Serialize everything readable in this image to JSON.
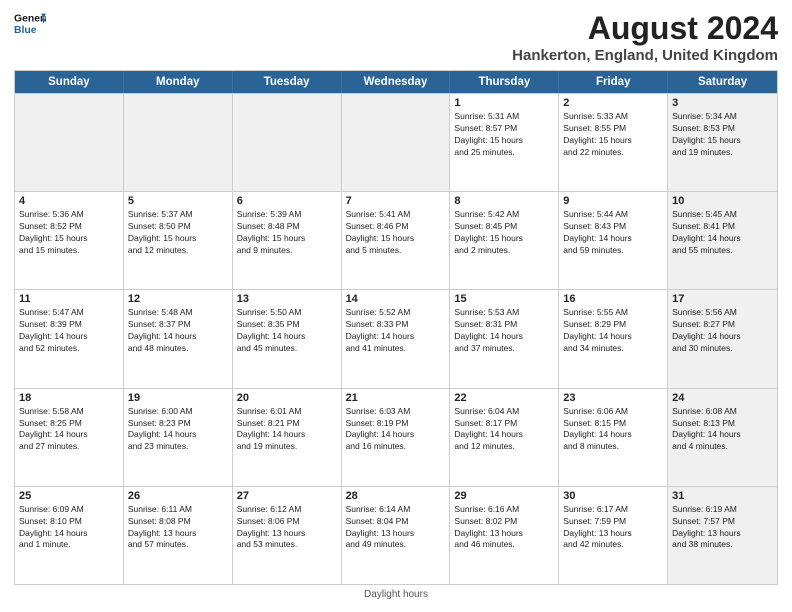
{
  "header": {
    "logo_line1": "General",
    "logo_line2": "Blue",
    "main_title": "August 2024",
    "subtitle": "Hankerton, England, United Kingdom"
  },
  "days_of_week": [
    "Sunday",
    "Monday",
    "Tuesday",
    "Wednesday",
    "Thursday",
    "Friday",
    "Saturday"
  ],
  "footer_text": "Daylight hours",
  "rows": [
    [
      {
        "day": "",
        "info": "",
        "shaded": true
      },
      {
        "day": "",
        "info": "",
        "shaded": true
      },
      {
        "day": "",
        "info": "",
        "shaded": true
      },
      {
        "day": "",
        "info": "",
        "shaded": true
      },
      {
        "day": "1",
        "info": "Sunrise: 5:31 AM\nSunset: 8:57 PM\nDaylight: 15 hours\nand 25 minutes.",
        "shaded": false
      },
      {
        "day": "2",
        "info": "Sunrise: 5:33 AM\nSunset: 8:55 PM\nDaylight: 15 hours\nand 22 minutes.",
        "shaded": false
      },
      {
        "day": "3",
        "info": "Sunrise: 5:34 AM\nSunset: 8:53 PM\nDaylight: 15 hours\nand 19 minutes.",
        "shaded": true
      }
    ],
    [
      {
        "day": "4",
        "info": "Sunrise: 5:36 AM\nSunset: 8:52 PM\nDaylight: 15 hours\nand 15 minutes.",
        "shaded": false
      },
      {
        "day": "5",
        "info": "Sunrise: 5:37 AM\nSunset: 8:50 PM\nDaylight: 15 hours\nand 12 minutes.",
        "shaded": false
      },
      {
        "day": "6",
        "info": "Sunrise: 5:39 AM\nSunset: 8:48 PM\nDaylight: 15 hours\nand 9 minutes.",
        "shaded": false
      },
      {
        "day": "7",
        "info": "Sunrise: 5:41 AM\nSunset: 8:46 PM\nDaylight: 15 hours\nand 5 minutes.",
        "shaded": false
      },
      {
        "day": "8",
        "info": "Sunrise: 5:42 AM\nSunset: 8:45 PM\nDaylight: 15 hours\nand 2 minutes.",
        "shaded": false
      },
      {
        "day": "9",
        "info": "Sunrise: 5:44 AM\nSunset: 8:43 PM\nDaylight: 14 hours\nand 59 minutes.",
        "shaded": false
      },
      {
        "day": "10",
        "info": "Sunrise: 5:45 AM\nSunset: 8:41 PM\nDaylight: 14 hours\nand 55 minutes.",
        "shaded": true
      }
    ],
    [
      {
        "day": "11",
        "info": "Sunrise: 5:47 AM\nSunset: 8:39 PM\nDaylight: 14 hours\nand 52 minutes.",
        "shaded": false
      },
      {
        "day": "12",
        "info": "Sunrise: 5:48 AM\nSunset: 8:37 PM\nDaylight: 14 hours\nand 48 minutes.",
        "shaded": false
      },
      {
        "day": "13",
        "info": "Sunrise: 5:50 AM\nSunset: 8:35 PM\nDaylight: 14 hours\nand 45 minutes.",
        "shaded": false
      },
      {
        "day": "14",
        "info": "Sunrise: 5:52 AM\nSunset: 8:33 PM\nDaylight: 14 hours\nand 41 minutes.",
        "shaded": false
      },
      {
        "day": "15",
        "info": "Sunrise: 5:53 AM\nSunset: 8:31 PM\nDaylight: 14 hours\nand 37 minutes.",
        "shaded": false
      },
      {
        "day": "16",
        "info": "Sunrise: 5:55 AM\nSunset: 8:29 PM\nDaylight: 14 hours\nand 34 minutes.",
        "shaded": false
      },
      {
        "day": "17",
        "info": "Sunrise: 5:56 AM\nSunset: 8:27 PM\nDaylight: 14 hours\nand 30 minutes.",
        "shaded": true
      }
    ],
    [
      {
        "day": "18",
        "info": "Sunrise: 5:58 AM\nSunset: 8:25 PM\nDaylight: 14 hours\nand 27 minutes.",
        "shaded": false
      },
      {
        "day": "19",
        "info": "Sunrise: 6:00 AM\nSunset: 8:23 PM\nDaylight: 14 hours\nand 23 minutes.",
        "shaded": false
      },
      {
        "day": "20",
        "info": "Sunrise: 6:01 AM\nSunset: 8:21 PM\nDaylight: 14 hours\nand 19 minutes.",
        "shaded": false
      },
      {
        "day": "21",
        "info": "Sunrise: 6:03 AM\nSunset: 8:19 PM\nDaylight: 14 hours\nand 16 minutes.",
        "shaded": false
      },
      {
        "day": "22",
        "info": "Sunrise: 6:04 AM\nSunset: 8:17 PM\nDaylight: 14 hours\nand 12 minutes.",
        "shaded": false
      },
      {
        "day": "23",
        "info": "Sunrise: 6:06 AM\nSunset: 8:15 PM\nDaylight: 14 hours\nand 8 minutes.",
        "shaded": false
      },
      {
        "day": "24",
        "info": "Sunrise: 6:08 AM\nSunset: 8:13 PM\nDaylight: 14 hours\nand 4 minutes.",
        "shaded": true
      }
    ],
    [
      {
        "day": "25",
        "info": "Sunrise: 6:09 AM\nSunset: 8:10 PM\nDaylight: 14 hours\nand 1 minute.",
        "shaded": false
      },
      {
        "day": "26",
        "info": "Sunrise: 6:11 AM\nSunset: 8:08 PM\nDaylight: 13 hours\nand 57 minutes.",
        "shaded": false
      },
      {
        "day": "27",
        "info": "Sunrise: 6:12 AM\nSunset: 8:06 PM\nDaylight: 13 hours\nand 53 minutes.",
        "shaded": false
      },
      {
        "day": "28",
        "info": "Sunrise: 6:14 AM\nSunset: 8:04 PM\nDaylight: 13 hours\nand 49 minutes.",
        "shaded": false
      },
      {
        "day": "29",
        "info": "Sunrise: 6:16 AM\nSunset: 8:02 PM\nDaylight: 13 hours\nand 46 minutes.",
        "shaded": false
      },
      {
        "day": "30",
        "info": "Sunrise: 6:17 AM\nSunset: 7:59 PM\nDaylight: 13 hours\nand 42 minutes.",
        "shaded": false
      },
      {
        "day": "31",
        "info": "Sunrise: 6:19 AM\nSunset: 7:57 PM\nDaylight: 13 hours\nand 38 minutes.",
        "shaded": true
      }
    ]
  ]
}
